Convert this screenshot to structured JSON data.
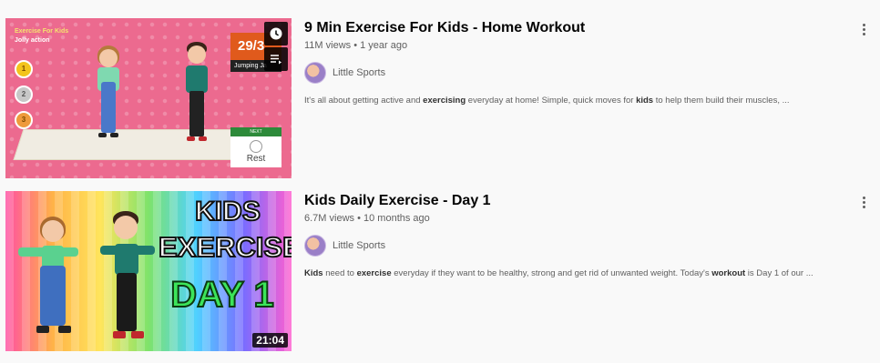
{
  "results": [
    {
      "title": "9 Min Exercise For Kids - Home Workout",
      "views": "11M views",
      "age": "1 year ago",
      "channel": "Little Sports",
      "description_parts": [
        {
          "text": "It's all about getting active and ",
          "bold": false
        },
        {
          "text": "exercising",
          "bold": true
        },
        {
          "text": " everyday at home! Simple, quick moves for ",
          "bold": false
        },
        {
          "text": "kids",
          "bold": true
        },
        {
          "text": " to help them build their muscles, ...",
          "bold": false
        }
      ],
      "thumbnail": {
        "corner_title": "Exercise For Kids",
        "corner_subtitle": "Jolly action",
        "rounds": [
          "1",
          "2",
          "3"
        ],
        "counter": "29/3",
        "counter_label": "Jumping Ja",
        "next_label": "NEXT",
        "next_text": "Rest",
        "background_color": "#ec6a8f"
      }
    },
    {
      "title": "Kids Daily Exercise - Day 1",
      "views": "6.7M views",
      "age": "10 months ago",
      "channel": "Little Sports",
      "description_parts": [
        {
          "text": "Kids",
          "bold": true
        },
        {
          "text": " need to ",
          "bold": false
        },
        {
          "text": "exercise",
          "bold": true
        },
        {
          "text": " everyday if they want to be healthy, strong and get rid of unwanted weight. Today's ",
          "bold": false
        },
        {
          "text": "workout",
          "bold": true
        },
        {
          "text": " is Day 1 of our ...",
          "bold": false
        }
      ],
      "thumbnail": {
        "line1": "KIDS",
        "line2": "EXERCISE",
        "line3": "DAY 1",
        "duration": "21:04"
      }
    }
  ],
  "icons": {
    "watch_later": "clock-icon",
    "add_to_queue": "queue-icon",
    "menu": "more-vert-icon"
  },
  "colors": {
    "title": "#030303",
    "meta": "#606060",
    "day_green": "#3ce45a"
  }
}
